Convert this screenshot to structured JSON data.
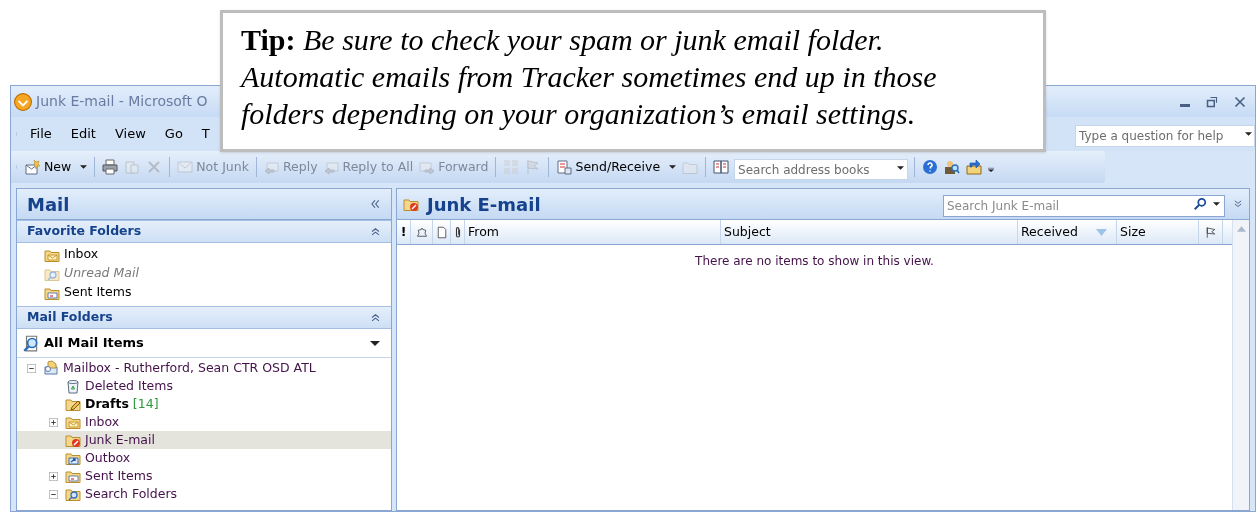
{
  "tip": {
    "text": "**Tip:**  *Be sure to check your spam or junk email folder. Automatic emails from Tracker sometimes end up in those folders depending on your organization’s email settings.*"
  },
  "window": {
    "title": "Junk E-mail - Microsoft O"
  },
  "menu": [
    "File",
    "Edit",
    "View",
    "Go",
    "T"
  ],
  "help": {
    "placeholder": "Type a question for help"
  },
  "toolbar": [
    {
      "kind": "button",
      "label": "New",
      "dropdown": true,
      "disabled": false
    },
    {
      "kind": "sep"
    },
    {
      "kind": "button",
      "disabled": false
    },
    {
      "kind": "button",
      "disabled": true
    },
    {
      "kind": "button",
      "disabled": true
    },
    {
      "kind": "sep"
    },
    {
      "kind": "button",
      "label": "Not Junk",
      "disabled": true
    },
    {
      "kind": "sep"
    },
    {
      "kind": "button",
      "label": "Reply",
      "disabled": true
    },
    {
      "kind": "button",
      "label": "Reply to All",
      "disabled": true
    },
    {
      "kind": "button",
      "label": "Forward",
      "disabled": true
    },
    {
      "kind": "sep"
    },
    {
      "kind": "button",
      "disabled": true
    },
    {
      "kind": "button",
      "disabled": true
    },
    {
      "kind": "sep"
    },
    {
      "kind": "button",
      "label": "Send/Receive",
      "dropdown": true,
      "disabled": false
    },
    {
      "kind": "button",
      "disabled": true
    },
    {
      "kind": "sep"
    },
    {
      "kind": "button",
      "disabled": false
    },
    {
      "kind": "search",
      "placeholder": "Search address books"
    },
    {
      "kind": "sep"
    },
    {
      "kind": "button",
      "disabled": false
    },
    {
      "kind": "button",
      "disabled": false
    },
    {
      "kind": "button",
      "disabled": false
    }
  ],
  "nav": {
    "title": "Mail",
    "favorites": {
      "title": "Favorite Folders",
      "items": [
        {
          "label": "Inbox",
          "kind": "inbox",
          "disabled": false
        },
        {
          "label": "Unread Mail",
          "kind": "search",
          "disabled": true
        },
        {
          "label": "Sent Items",
          "kind": "sent",
          "disabled": false
        }
      ]
    },
    "mail_folders": {
      "title": "Mail Folders",
      "view": "All Mail Items",
      "tree": [
        {
          "label": "Mailbox - Rutherford, Sean CTR OSD ATL",
          "kind": "mailbox",
          "expanded": true,
          "selected": false,
          "children": [
            {
              "label": "Deleted Items",
              "kind": "trash",
              "selected": false
            },
            {
              "label": "Drafts",
              "count": "[14]",
              "kind": "drafts",
              "selected": false
            },
            {
              "label": "Inbox",
              "kind": "inbox",
              "expanded": false,
              "selected": false
            },
            {
              "label": "Junk E-mail",
              "kind": "junk",
              "selected": true
            },
            {
              "label": "Outbox",
              "kind": "outbox",
              "selected": false
            },
            {
              "label": "Sent Items",
              "kind": "sent",
              "expanded": false,
              "selected": false
            },
            {
              "label": "Search Folders",
              "kind": "search",
              "expanded": true,
              "selected": false
            }
          ]
        }
      ]
    }
  },
  "folder_view": {
    "title": "Junk E-mail",
    "search": {
      "placeholder": "Search Junk E-mail"
    },
    "columns": [
      {
        "kind": "text",
        "label": "!"
      },
      {
        "kind": "bell"
      },
      {
        "kind": "page"
      },
      {
        "kind": "clip"
      },
      {
        "kind": "text",
        "label": "From"
      },
      {
        "kind": "text",
        "label": "Subject"
      },
      {
        "kind": "text",
        "label": "Received",
        "sorted": true
      },
      {
        "kind": "text",
        "label": "Size"
      },
      {
        "kind": "flag"
      }
    ],
    "empty_message": "There are no items to show in this view."
  }
}
